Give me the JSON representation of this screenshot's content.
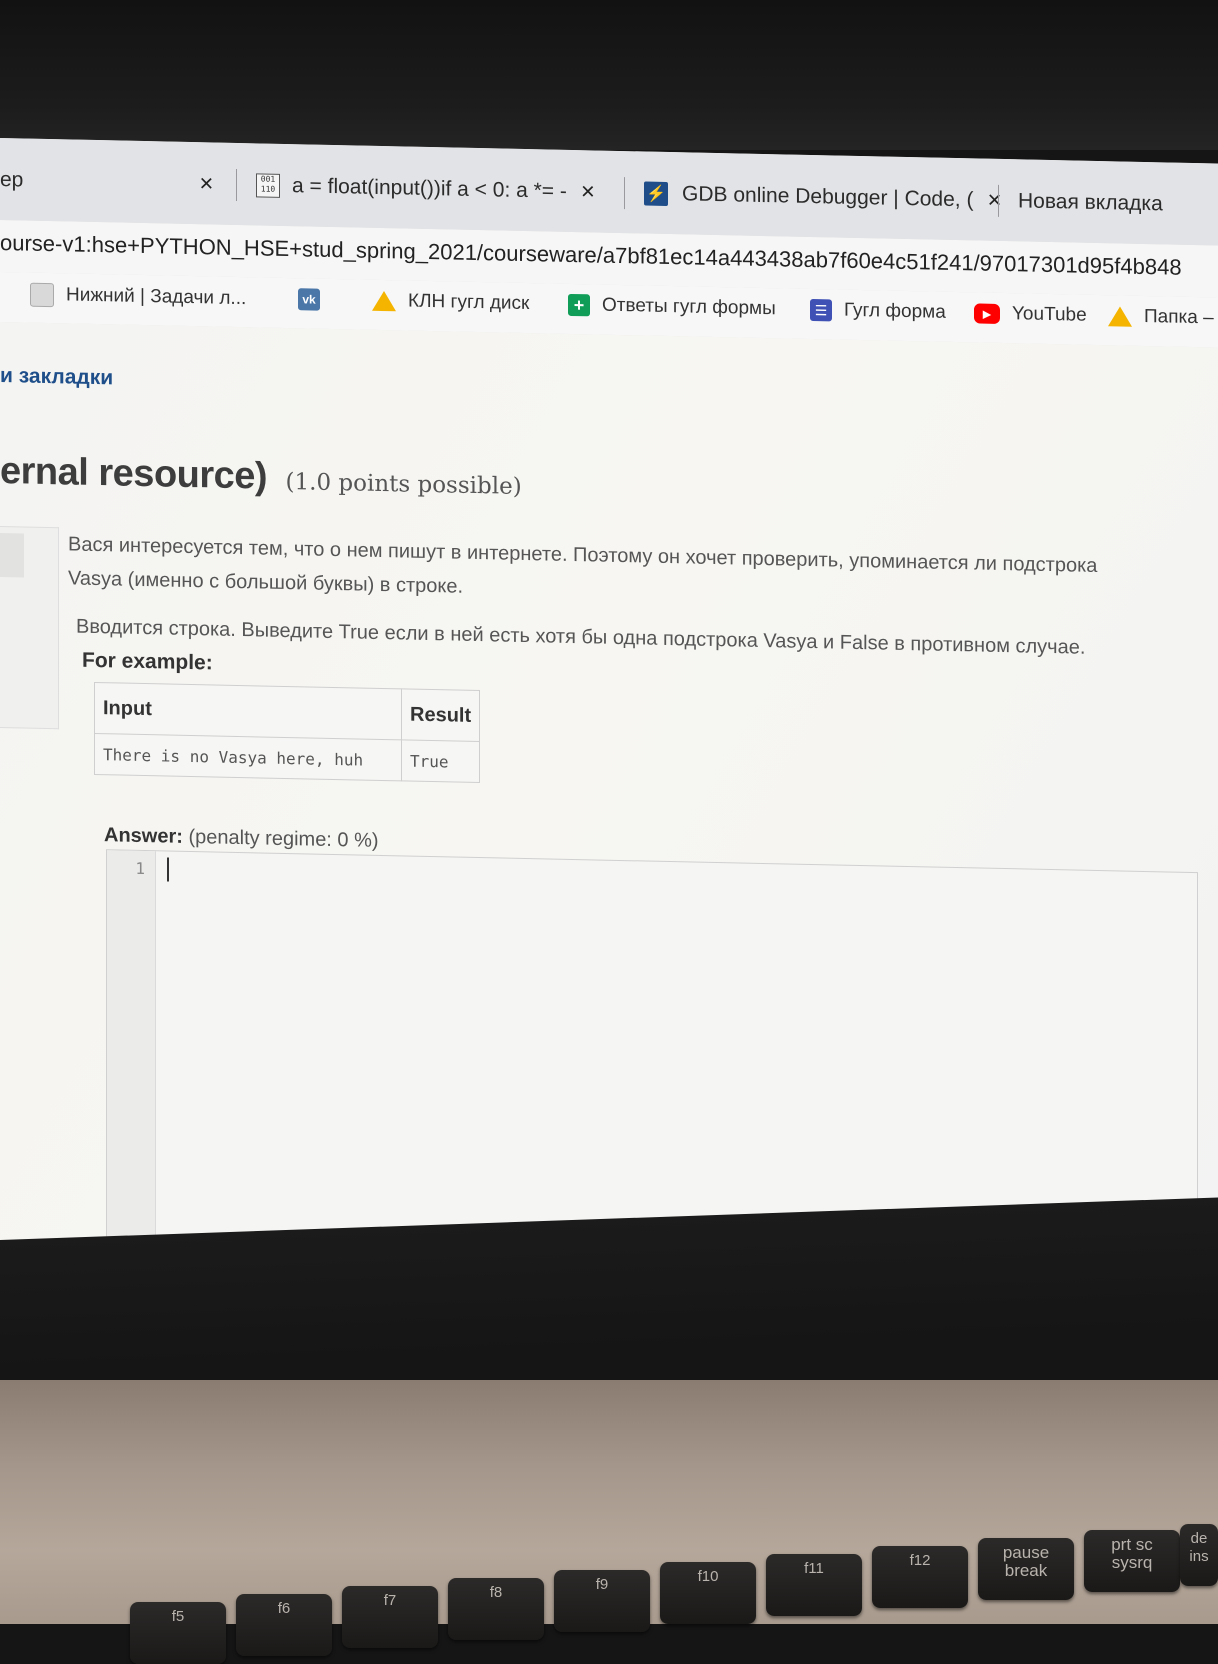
{
  "tabs": [
    {
      "label": "ep",
      "close": "×"
    },
    {
      "label": "a = float(input())if a < 0: a *= -",
      "favicon_text": "001\n110",
      "close": "×"
    },
    {
      "label": "GDB online Debugger | Code, (",
      "close": "×"
    },
    {
      "label": "Новая вкладка"
    }
  ],
  "address": {
    "url": "ourse-v1:hse+PYTHON_HSE+stud_spring_2021/courseware/a7bf81ec14a443438ab7f60e4c51f241/97017301d95f4b848"
  },
  "bookmarks": [
    {
      "label": "Нижний | Задачи л...",
      "icon": "page-icon"
    },
    {
      "label": "",
      "icon": "vk-icon",
      "icon_text": "vk"
    },
    {
      "label": "КЛН гугл диск",
      "icon": "google-drive-icon"
    },
    {
      "label": "Ответы гугл формы",
      "icon": "google-sheets-icon"
    },
    {
      "label": "Гугл форма",
      "icon": "google-forms-icon"
    },
    {
      "label": "YouTube",
      "icon": "youtube-icon"
    },
    {
      "label": "Папка –",
      "icon": "google-drive-icon"
    }
  ],
  "page": {
    "bookmarks_link": "и закладки",
    "heading": "ernal resource)",
    "points": "(1.0 points possible)",
    "question_line1": "Вася интересуется тем, что о нем пишут в интернете. Поэтому он хочет проверить, упоминается ли подстрока",
    "question_line2": "Vasya (именно с большой буквы) в строке.",
    "question_line3": "Вводится строка. Выведите True если в ней есть хотя бы одна подстрока Vasya и False в противном случае.",
    "example_label": "For example:",
    "example_table": {
      "headers": [
        "Input",
        "Result"
      ],
      "rows": [
        [
          "There is no Vasya here, huh",
          "True"
        ]
      ]
    },
    "answer_label": "Answer:",
    "penalty": "(penalty regime: 0 %)",
    "editor_line_number": "1"
  },
  "keyboard": {
    "keys": [
      "f5",
      "f6",
      "f7",
      "f8",
      "f9",
      "f10",
      "f11",
      "f12",
      "pause\nbreak",
      "prt sc\nsysrq",
      "de\nins"
    ]
  }
}
